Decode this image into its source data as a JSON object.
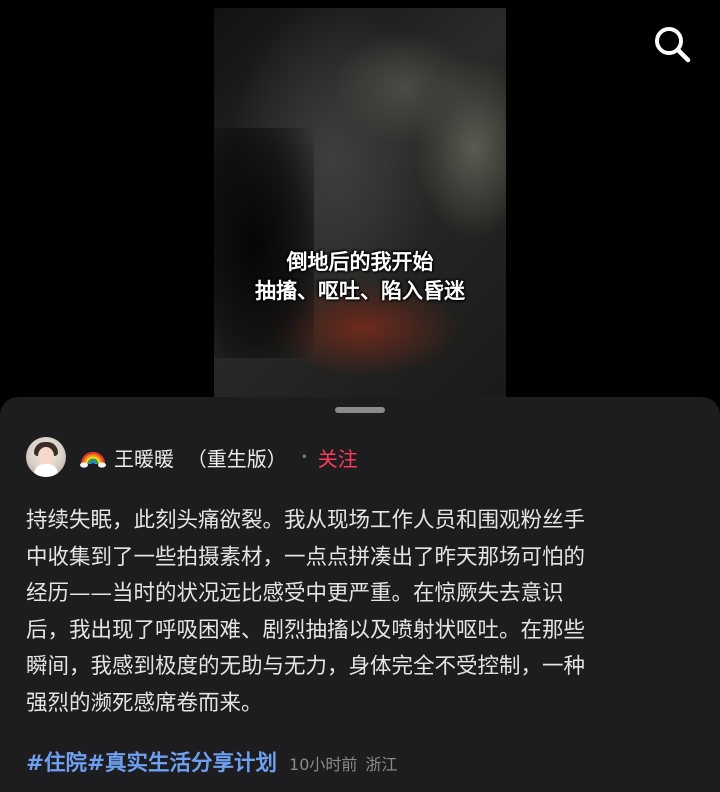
{
  "video": {
    "caption_line1": "倒地后的我开始",
    "caption_line2": "抽搐、呕吐、陷入昏迷"
  },
  "header": {
    "search_icon": "search-icon"
  },
  "post": {
    "author": {
      "emoji_icon": "rainbow-icon",
      "name": "王暖暖  （重生版）",
      "follow_label": "关注"
    },
    "body_lines": [
      "持续失眠，此刻头痛欲裂。我从现场工作人员和围观粉丝手",
      "中收集到了一些拍摄素材，一点点拼凑出了昨天那场可怕的",
      "经历——当时的状况远比感受中更严重。在惊厥失去意识",
      "后，我出现了呼吸困难、剧烈抽搐以及喷射状呕吐。在那些",
      "瞬间，我感到极度的无助与无力，身体完全不受控制，一种",
      "强烈的濒死感席卷而来。"
    ],
    "hashtags": [
      "#住院",
      "#真实生活分享计划"
    ],
    "time": "10小时前",
    "location": "浙江"
  },
  "colors": {
    "background": "#000000",
    "sheet": "#1d1d1f",
    "follow": "#ff3b5c",
    "hashtag": "#6e9ff0",
    "meta": "#8a8a8c"
  }
}
